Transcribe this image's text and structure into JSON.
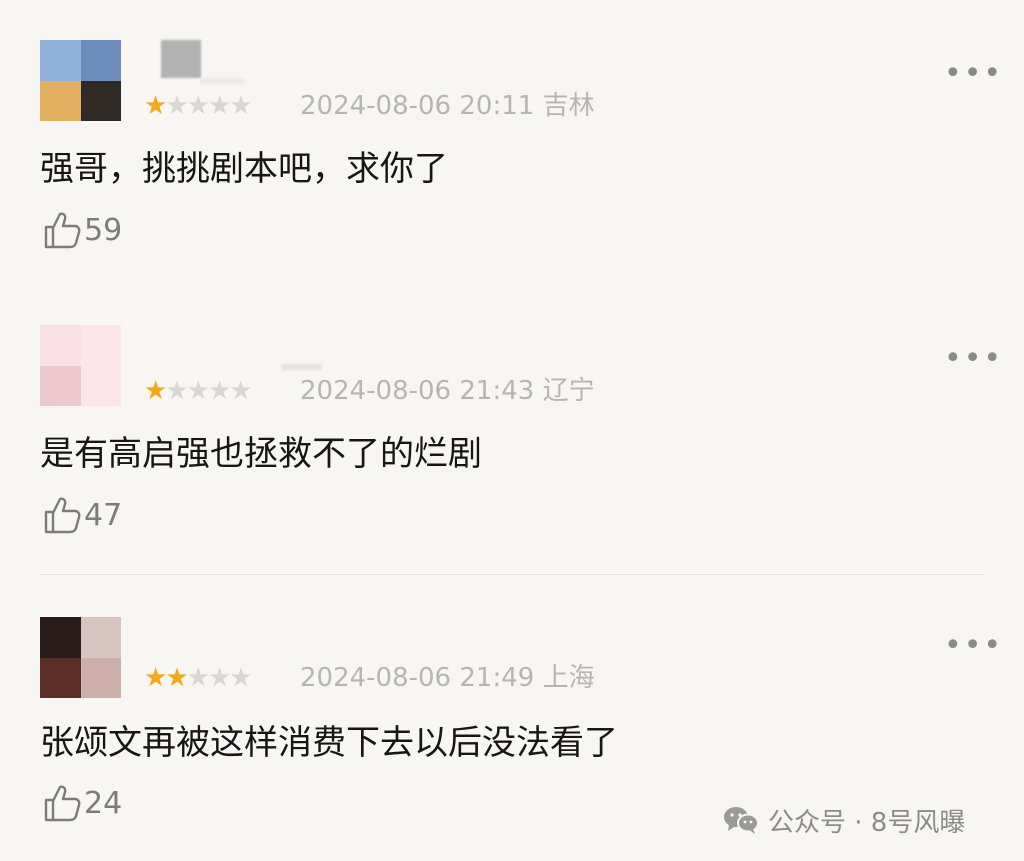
{
  "comments": [
    {
      "avatar_colors": [
        "#8fb0d8",
        "#6e8cbc",
        "#e3b062",
        "#2f2a25"
      ],
      "username_blur_color": "#b5b5b5",
      "stars_filled": 1,
      "stars_total": 5,
      "star_on": "★",
      "star_off_1": "★",
      "star_off_2": "★",
      "star_off_3": "★",
      "star_off_4": "★",
      "date": "2024-08-06 20:11",
      "location": "吉林",
      "text": "强哥，挑挑剧本吧，求你了",
      "likes": "59",
      "more": "•••"
    },
    {
      "avatar_colors": [
        "#fbe1e5",
        "#fde6ea",
        "#ecc8cf",
        "#fde6ea"
      ],
      "username_blur_color": "#e6e4e2",
      "stars_filled": 1,
      "stars_total": 5,
      "star_on": "★",
      "star_off_1": "★",
      "star_off_2": "★",
      "star_off_3": "★",
      "star_off_4": "★",
      "date": "2024-08-06 21:43",
      "location": "辽宁",
      "text": "是有高启强也拯救不了的烂剧",
      "likes": "47",
      "more": "•••"
    },
    {
      "avatar_colors": [
        "#2a1c1a",
        "#d6c5c0",
        "#5a2e27",
        "#cdb0ac"
      ],
      "username_blur_color": "#f7f6f2",
      "stars_filled": 2,
      "stars_total": 5,
      "star_on_1": "★",
      "star_on_2": "★",
      "star_off_1": "★",
      "star_off_2": "★",
      "star_off_3": "★",
      "date": "2024-08-06 21:49",
      "location": "上海",
      "text": "张颂文再被这样消费下去以后没法看了",
      "likes": "24",
      "more": "•••"
    }
  ],
  "watermark": {
    "icon": "wechat-icon",
    "text": "公众号 · 8号风曝"
  },
  "colors": {
    "background": "#f7f6f2",
    "star_on": "#f4a81c",
    "star_off": "#d8d7d3",
    "meta": "#b6b5b1",
    "text": "#161616"
  }
}
